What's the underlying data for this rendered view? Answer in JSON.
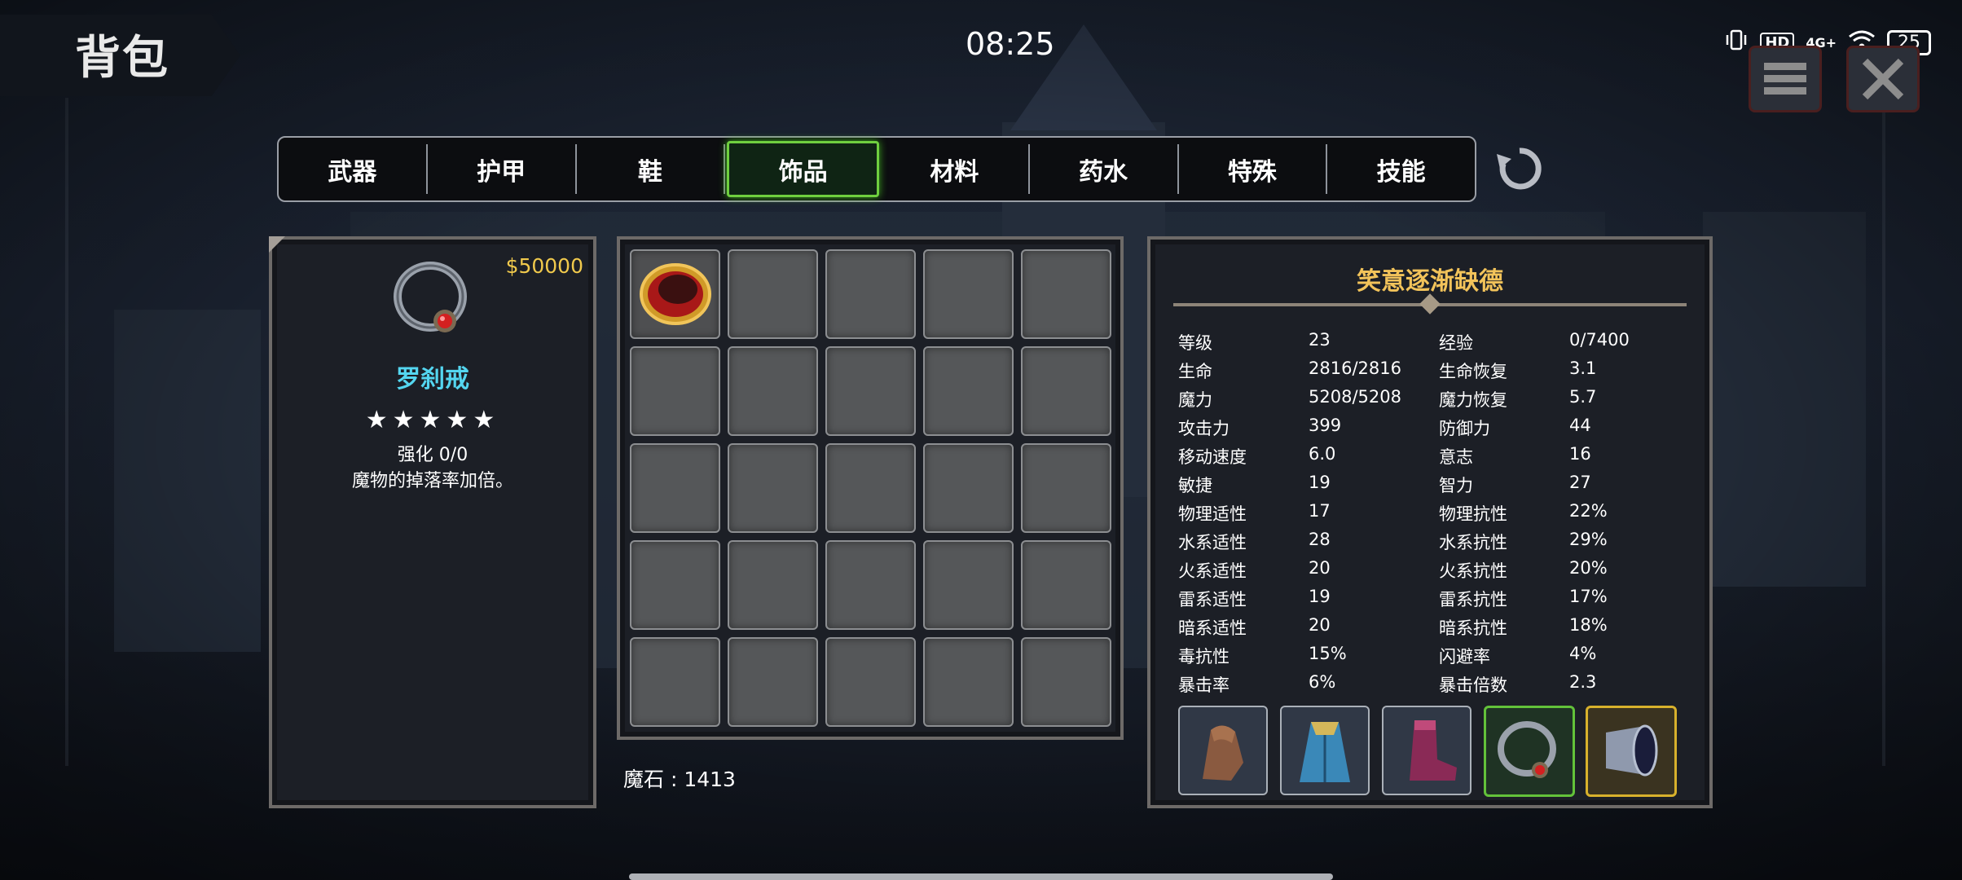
{
  "header": {
    "title": "背包",
    "clock": "08:25",
    "battery": "25",
    "hd_label": "HD",
    "net_label": "4G+"
  },
  "tabs": [
    {
      "label": "武器",
      "active": false
    },
    {
      "label": "护甲",
      "active": false
    },
    {
      "label": "鞋",
      "active": false
    },
    {
      "label": "饰品",
      "active": true
    },
    {
      "label": "材料",
      "active": false
    },
    {
      "label": "药水",
      "active": false
    },
    {
      "label": "特殊",
      "active": false
    },
    {
      "label": "技能",
      "active": false
    }
  ],
  "detail": {
    "price": "$50000",
    "item_name": "罗刹戒",
    "stars": "★★★★★",
    "star_count": 5,
    "enhance": "强化 0/0",
    "description": "魔物的掉落率加倍。",
    "icon": "ring-red-gem-icon"
  },
  "inventory": {
    "rows": 5,
    "cols": 5,
    "filled_slots": [
      {
        "index": 0,
        "icon": "gold-ring-icon"
      }
    ],
    "magic_stone": "魔石 : 1413"
  },
  "stats": {
    "character_name": "笑意逐渐缺德",
    "rows": [
      [
        "等级",
        "23",
        "经验",
        "0/7400"
      ],
      [
        "生命",
        "2816/2816",
        "生命恢复",
        "3.1"
      ],
      [
        "魔力",
        "5208/5208",
        "魔力恢复",
        "5.7"
      ],
      [
        "攻击力",
        "399",
        "防御力",
        "44"
      ],
      [
        "移动速度",
        "6.0",
        "意志",
        "16"
      ],
      [
        "敏捷",
        "19",
        "智力",
        "27"
      ],
      [
        "物理适性",
        "17",
        "物理抗性",
        "22%"
      ],
      [
        "水系适性",
        "28",
        "水系抗性",
        "29%"
      ],
      [
        "火系适性",
        "20",
        "火系抗性",
        "20%"
      ],
      [
        "雷系适性",
        "19",
        "雷系抗性",
        "17%"
      ],
      [
        "暗系适性",
        "20",
        "暗系抗性",
        "18%"
      ],
      [
        "毒抗性",
        "15%",
        "闪避率",
        "4%"
      ],
      [
        "暴击率",
        "6%",
        "暴击倍数",
        "2.3"
      ]
    ],
    "equipment": [
      {
        "icon": "leather-glove-icon",
        "highlight": "none"
      },
      {
        "icon": "blue-robe-icon",
        "highlight": "none"
      },
      {
        "icon": "purple-boot-icon",
        "highlight": "none"
      },
      {
        "icon": "ring-red-gem-icon",
        "highlight": "green"
      },
      {
        "icon": "metal-bracer-icon",
        "highlight": "yellow"
      }
    ]
  },
  "colors": {
    "accent_green": "#6fcf3f",
    "price_gold": "#f0c94c",
    "name_cyan": "#54d6f0",
    "char_gold": "#f2c35a"
  }
}
